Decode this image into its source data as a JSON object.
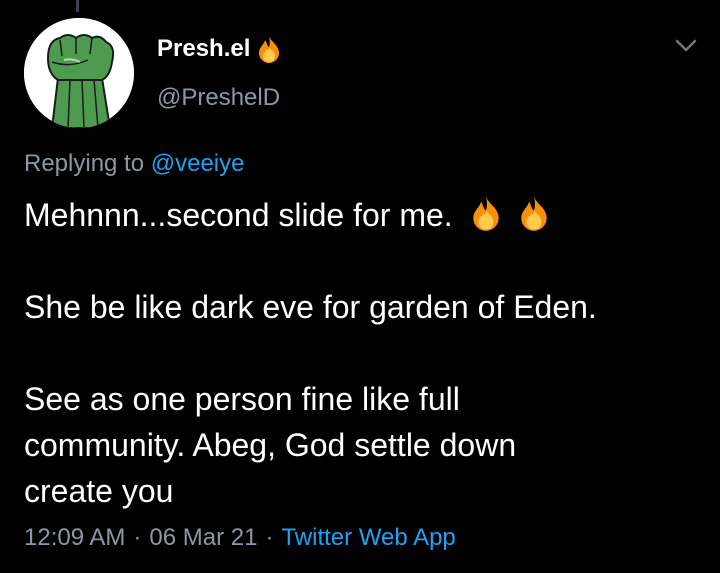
{
  "tweet": {
    "author": {
      "display_name": "Presh.el",
      "display_name_emoji": "fire-emoji",
      "handle": "@PreshelD"
    },
    "replying_to_prefix": "Replying to",
    "replying_to_handle": "@veeiye",
    "lines": [
      "Mehnnn...second slide for me.",
      "She be like dark eve for garden of Eden.",
      "See as one person fine like full",
      "community. Abeg, God settle down",
      "create you"
    ],
    "line1_emojis": [
      "fire-emoji",
      "fire-emoji"
    ],
    "time": "12:09 AM",
    "date": "06 Mar 21",
    "source": "Twitter Web App",
    "separator": "·"
  },
  "icons": {
    "menu": "chevron-down-icon",
    "avatar": "raised-fist-avatar"
  },
  "colors": {
    "background": "#000000",
    "text_primary": "#ffffff",
    "text_secondary": "#8899a6",
    "link": "#1da1f2",
    "avatar_fist": "#4e9a4e"
  }
}
